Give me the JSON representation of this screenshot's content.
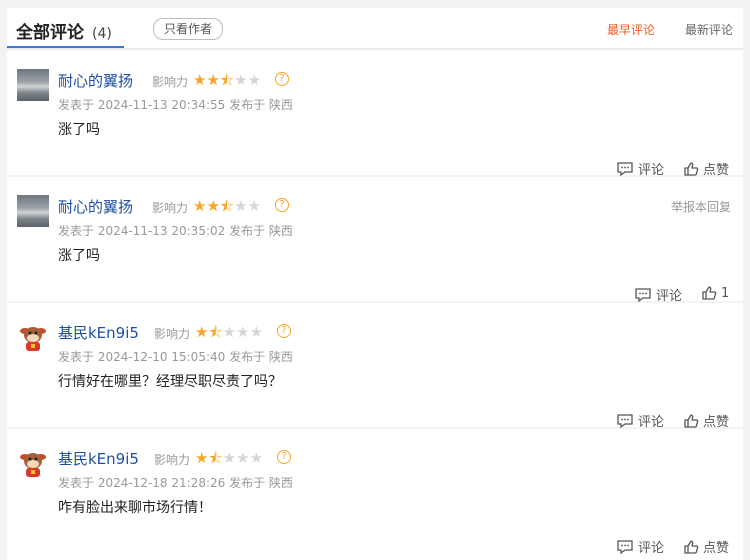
{
  "header": {
    "title": "全部评论",
    "count": "(4)",
    "author_only": "只看作者",
    "sort_earliest": "最早评论",
    "sort_newest": "最新评论"
  },
  "labels": {
    "influence": "影响力",
    "comment": "评论",
    "like": "点赞",
    "report": "举报本回复"
  },
  "comments": [
    {
      "name": "耐心的翼扬",
      "avatar": "landscape-photo",
      "rating": 2.5,
      "stars": "★★⯪☆☆",
      "meta": "发表于 2024-11-13 20:34:55 发布于 陕西",
      "content": "涨了吗",
      "comment_label": "评论",
      "like_label": "点赞"
    },
    {
      "name": "耐心的翼扬",
      "avatar": "landscape-photo",
      "rating": 2.5,
      "stars": "★★⯪☆☆",
      "meta": "发表于 2024-11-13 20:35:02 发布于 陕西",
      "content": "涨了吗",
      "comment_label": "评论",
      "like_label": "1"
    },
    {
      "name": "基民kEn9i5",
      "avatar": "cartoon-cow",
      "rating": 1.5,
      "stars": "★⯪☆☆☆",
      "meta": "发表于 2024-12-10 15:05:40 发布于 陕西",
      "content": "行情好在哪里？经理尽职尽责了吗？",
      "comment_label": "评论",
      "like_label": "点赞"
    },
    {
      "name": "基民kEn9i5",
      "avatar": "cartoon-cow",
      "rating": 1.5,
      "stars": "★⯪☆☆☆",
      "meta": "发表于 2024-12-18 21:28:26 发布于 陕西",
      "content": "咋有脸出来聊市场行情！",
      "comment_label": "评论",
      "like_label": "点赞"
    }
  ],
  "colors": {
    "accent_orange": "#f05a24",
    "star": "#f6a623",
    "name_blue": "#1f4fa3",
    "tab_underline": "#3b78dd"
  }
}
